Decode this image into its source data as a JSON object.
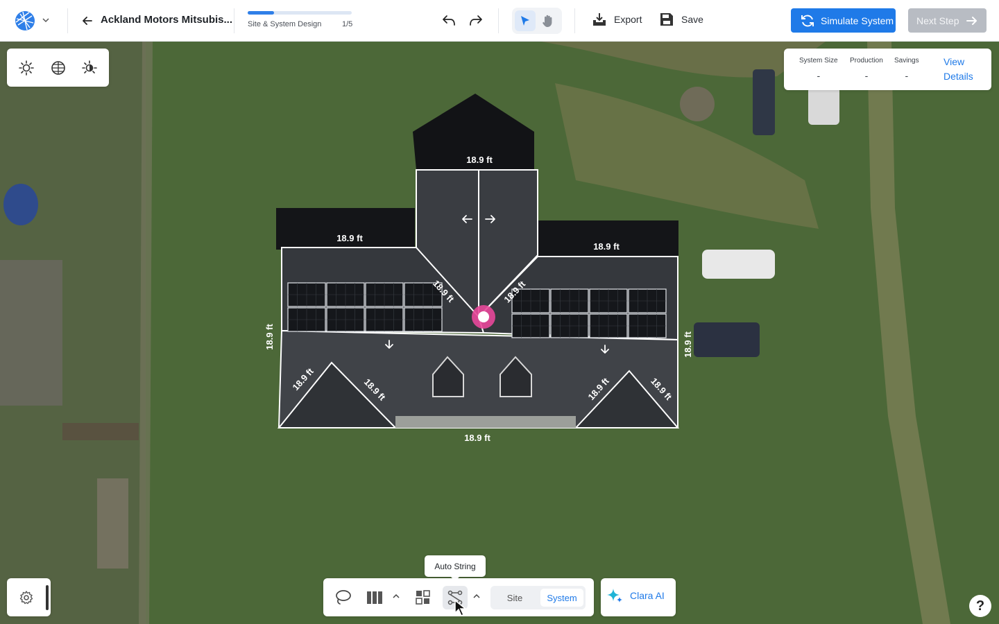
{
  "header": {
    "project_title": "Ackland Motors Mitsubis...",
    "progress": {
      "label": "Site & System Design",
      "step": "1/5",
      "fraction": 0.25
    },
    "export_label": "Export",
    "save_label": "Save",
    "simulate_label": "Simulate System",
    "next_label": "Next Step"
  },
  "stats": {
    "system_size": {
      "label": "System Size",
      "value": "-"
    },
    "production": {
      "label": "Production",
      "value": "-"
    },
    "savings": {
      "label": "Savings",
      "value": "-"
    },
    "view_details": "View Details"
  },
  "view_modes": [
    "sun-icon",
    "globe-grid-icon",
    "shade-sun-icon"
  ],
  "map": {
    "dimension_label": "18.9 ft"
  },
  "bottom_toolbar": {
    "tooltip": "Auto String",
    "segment": {
      "site": "Site",
      "system": "System",
      "active": "System"
    },
    "clara_label": "Clara AI"
  },
  "help_label": "?",
  "colors": {
    "accent": "#1f7ae8",
    "marker": "#e8489a",
    "disabled": "#b8bcc3"
  }
}
